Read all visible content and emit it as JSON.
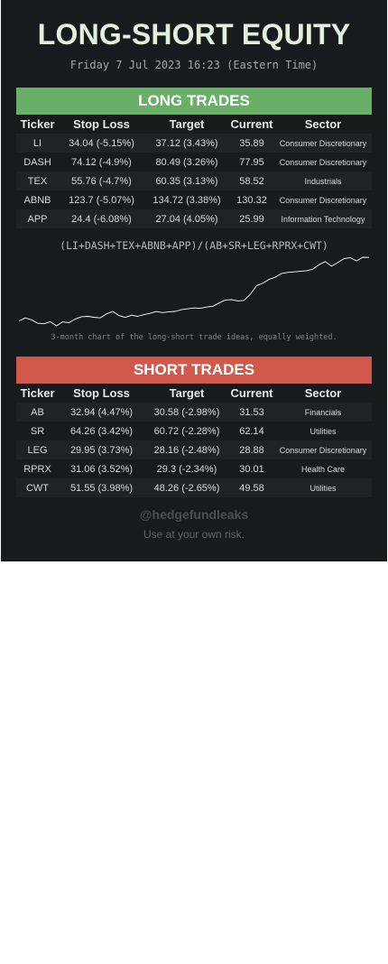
{
  "header": {
    "title": "LONG-SHORT EQUITY",
    "subtitle": "Friday 7 Jul 2023 16:23 (Eastern Time)"
  },
  "columns": [
    "Ticker",
    "Stop Loss",
    "Target",
    "Current",
    "Sector"
  ],
  "long": {
    "banner": "LONG TRADES",
    "rows": [
      {
        "ticker": "LI",
        "stop_loss": "34.04 (-5.15%)",
        "target": "37.12 (3.43%)",
        "current": "35.89",
        "sector": "Consumer Discretionary"
      },
      {
        "ticker": "DASH",
        "stop_loss": "74.12 (-4.9%)",
        "target": "80.49 (3.26%)",
        "current": "77.95",
        "sector": "Consumer Discretionary"
      },
      {
        "ticker": "TEX",
        "stop_loss": "55.76 (-4.7%)",
        "target": "60.35 (3.13%)",
        "current": "58.52",
        "sector": "Industrials"
      },
      {
        "ticker": "ABNB",
        "stop_loss": "123.7 (-5.07%)",
        "target": "134.72 (3.38%)",
        "current": "130.32",
        "sector": "Consumer Discretionary"
      },
      {
        "ticker": "APP",
        "stop_loss": "24.4 (-6.08%)",
        "target": "27.04 (4.05%)",
        "current": "25.99",
        "sector": "Information Technology"
      }
    ]
  },
  "chart": {
    "formula": "(LI+DASH+TEX+ABNB+APP)/(AB+SR+LEG+RPRX+CWT)",
    "caption": "3-month chart of the long-short trade ideas, equally weighted.",
    "line_color": "#ffffff"
  },
  "chart_data": {
    "type": "line",
    "title": "",
    "xlabel": "",
    "ylabel": "",
    "grid": false,
    "series": [
      {
        "values": [
          0.6,
          2.2,
          1.2,
          -0.6,
          -0.9,
          0.2,
          -2.0,
          0.1,
          -0.4,
          1.6,
          2.8,
          3.0,
          2.5,
          2.2,
          4.3,
          5.6,
          3.4,
          2.4,
          3.6,
          3.0,
          3.9,
          4.6,
          5.5,
          5.0,
          5.4,
          5.6,
          6.5,
          7.0,
          7.4,
          7.2,
          7.9,
          8.3,
          10.0,
          11.6,
          11.8,
          11.1,
          11.4,
          14.6,
          19.1,
          20.4,
          22.4,
          23.6,
          25.6,
          26.1,
          26.4,
          26.7,
          27.0,
          27.8,
          30.2,
          31.8,
          29.4,
          31.4,
          33.4,
          33.8,
          32.2,
          34.1,
          34.0
        ]
      }
    ]
  },
  "short": {
    "banner": "SHORT TRADES",
    "rows": [
      {
        "ticker": "AB",
        "stop_loss": "32.94 (4.47%)",
        "target": "30.58 (-2.98%)",
        "current": "31.53",
        "sector": "Financials"
      },
      {
        "ticker": "SR",
        "stop_loss": "64.26 (3.42%)",
        "target": "60.72 (-2.28%)",
        "current": "62.14",
        "sector": "Utilities"
      },
      {
        "ticker": "LEG",
        "stop_loss": "29.95 (3.73%)",
        "target": "28.16 (-2.48%)",
        "current": "28.88",
        "sector": "Consumer Discretionary"
      },
      {
        "ticker": "RPRX",
        "stop_loss": "31.06 (3.52%)",
        "target": "29.3 (-2.34%)",
        "current": "30.01",
        "sector": "Health Care"
      },
      {
        "ticker": "CWT",
        "stop_loss": "51.55 (3.98%)",
        "target": "48.26 (-2.65%)",
        "current": "49.58",
        "sector": "Utilities"
      }
    ]
  },
  "footer": {
    "handle": "@hedgefundleaks",
    "disclaimer": "Use at your own risk."
  }
}
